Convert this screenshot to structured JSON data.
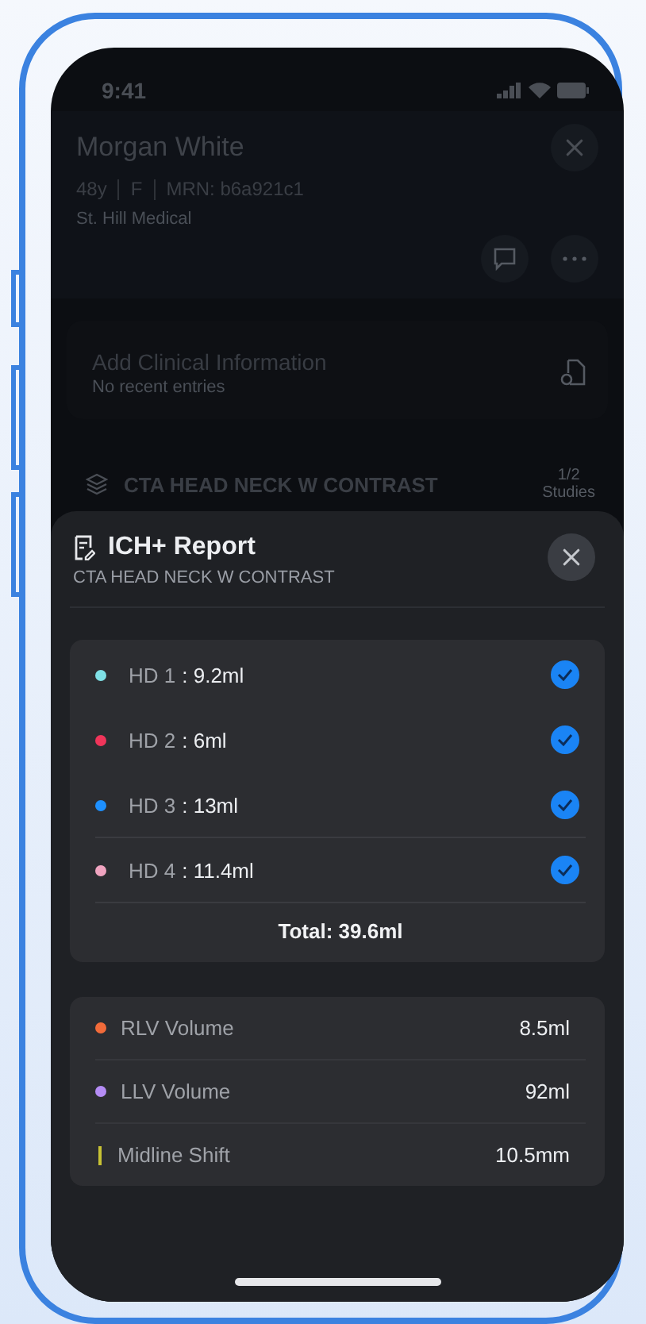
{
  "status_bar": {
    "time": "9:41"
  },
  "patient": {
    "name": "Morgan White",
    "age": "48y",
    "sex": "F",
    "mrn": "MRN: b6a921c1",
    "facility": "St. Hill Medical"
  },
  "clinical_card": {
    "title": "Add Clinical Information",
    "subtitle": "No recent entries"
  },
  "study": {
    "label": "CTA HEAD NECK W CONTRAST",
    "count": "1/2",
    "count_label": "Studies"
  },
  "report": {
    "title": "ICH+ Report",
    "subtitle": "CTA HEAD NECK W CONTRAST",
    "hemorrhages": [
      {
        "label": "HD 1",
        "value": ": 9.2ml",
        "color": "#7fe0e6",
        "checked": true
      },
      {
        "label": "HD 2",
        "value": ": 6ml",
        "color": "#f0355a",
        "checked": true
      },
      {
        "label": "HD 3",
        "value": ": 13ml",
        "color": "#1e90ff",
        "checked": true
      },
      {
        "label": "HD 4",
        "value": ": 11.4ml",
        "color": "#f0a4c0",
        "checked": true
      }
    ],
    "total": "Total: 39.6ml",
    "metrics": [
      {
        "kind": "dot",
        "label": "RLV Volume",
        "value": "8.5ml",
        "color": "#f26b3a"
      },
      {
        "kind": "dot",
        "label": "LLV Volume",
        "value": "92ml",
        "color": "#b58cf5"
      },
      {
        "kind": "bar",
        "label": "Midline Shift",
        "value": "10.5mm",
        "color": "#c8c234"
      }
    ]
  }
}
